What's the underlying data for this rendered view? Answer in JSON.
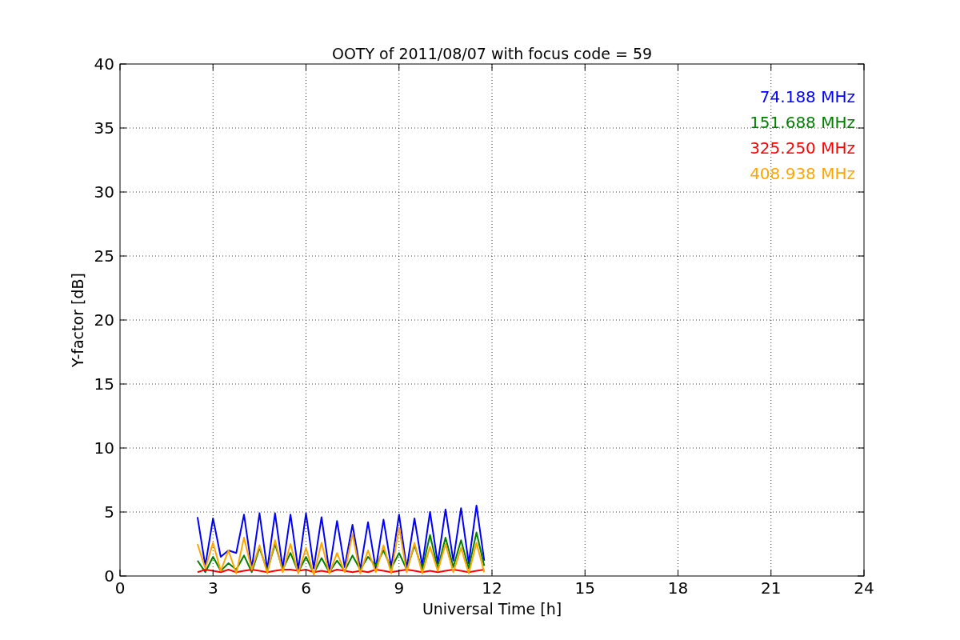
{
  "chart_data": {
    "type": "line",
    "title": "OOTY of 2011/08/07 with focus code = 59",
    "xlabel": "Universal Time [h]",
    "ylabel": "Y-factor [dB]",
    "x": [
      2.5,
      2.75,
      3.0,
      3.25,
      3.5,
      3.75,
      4.0,
      4.25,
      4.5,
      4.75,
      5.0,
      5.25,
      5.5,
      5.75,
      6.0,
      6.25,
      6.5,
      6.75,
      7.0,
      7.25,
      7.5,
      7.75,
      8.0,
      8.25,
      8.5,
      8.75,
      9.0,
      9.25,
      9.5,
      9.75,
      10.0,
      10.25,
      10.5,
      10.75,
      11.0,
      11.25,
      11.5,
      11.75
    ],
    "series": [
      {
        "name": "74.188 MHz",
        "color": "#0000ff",
        "values": [
          4.6,
          0.8,
          4.5,
          1.5,
          2.0,
          1.8,
          4.8,
          0.6,
          4.9,
          0.5,
          4.9,
          0.6,
          4.8,
          0.5,
          4.9,
          0.6,
          4.6,
          0.4,
          4.3,
          0.7,
          4.0,
          0.5,
          4.2,
          0.6,
          4.4,
          0.7,
          4.8,
          0.6,
          4.5,
          0.8,
          5.0,
          1.0,
          5.2,
          1.2,
          5.3,
          1.0,
          5.5,
          1.2
        ]
      },
      {
        "name": "151.688 MHz",
        "color": "#008000",
        "values": [
          1.2,
          0.3,
          1.5,
          0.4,
          1.0,
          0.5,
          1.6,
          0.3,
          2.2,
          0.4,
          2.5,
          0.5,
          1.8,
          0.3,
          1.5,
          0.2,
          1.4,
          0.3,
          1.2,
          0.4,
          1.6,
          0.5,
          1.5,
          0.8,
          2.0,
          0.6,
          1.8,
          0.5,
          2.4,
          0.5,
          3.2,
          0.6,
          3.0,
          0.7,
          2.8,
          0.6,
          3.4,
          0.8
        ]
      },
      {
        "name": "325.250 MHz",
        "color": "#ff0000",
        "values": [
          0.3,
          0.5,
          0.4,
          0.3,
          0.5,
          0.3,
          0.4,
          0.5,
          0.4,
          0.3,
          0.4,
          0.5,
          0.5,
          0.4,
          0.5,
          0.3,
          0.4,
          0.3,
          0.5,
          0.4,
          0.3,
          0.4,
          0.3,
          0.5,
          0.4,
          0.3,
          0.4,
          0.5,
          0.4,
          0.3,
          0.4,
          0.3,
          0.4,
          0.5,
          0.4,
          0.3,
          0.4,
          0.5
        ]
      },
      {
        "name": "408.938 MHz",
        "color": "#ffa500",
        "values": [
          2.5,
          0.6,
          2.6,
          0.4,
          2.0,
          0.2,
          3.0,
          0.5,
          2.4,
          0.2,
          2.8,
          0.3,
          2.5,
          0.2,
          2.2,
          0.1,
          2.6,
          0.2,
          1.8,
          0.3,
          3.3,
          0.2,
          2.0,
          0.3,
          2.4,
          0.2,
          3.8,
          0.3,
          2.6,
          0.2,
          2.3,
          0.4,
          2.5,
          0.3,
          2.2,
          0.2,
          2.6,
          0.3
        ]
      }
    ],
    "grid": true,
    "xlim": [
      0,
      24
    ],
    "ylim": [
      0,
      40
    ],
    "xticks": [
      0,
      3,
      6,
      9,
      12,
      15,
      18,
      21,
      24
    ],
    "yticks": [
      0,
      5,
      10,
      15,
      20,
      25,
      30,
      35,
      40
    ]
  }
}
